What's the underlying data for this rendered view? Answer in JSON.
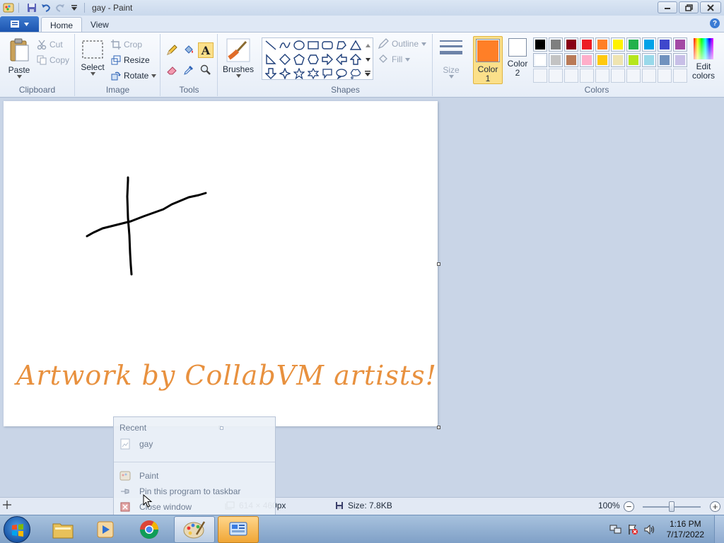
{
  "window": {
    "title": "gay - Paint"
  },
  "tabs": {
    "home": "Home",
    "view": "View"
  },
  "clipboard": {
    "paste": "Paste",
    "cut": "Cut",
    "copy": "Copy",
    "group_label": "Clipboard"
  },
  "image": {
    "select": "Select",
    "crop": "Crop",
    "resize": "Resize",
    "rotate": "Rotate",
    "group_label": "Image"
  },
  "tools": {
    "group_label": "Tools",
    "selected_tool": "text-tool",
    "text_tool_glyph": "A"
  },
  "brushes": {
    "label": "Brushes"
  },
  "shapes": {
    "outline": "Outline",
    "fill": "Fill",
    "group_label": "Shapes"
  },
  "size": {
    "label": "Size"
  },
  "colors": {
    "color1_label": "Color 1",
    "color2_label": "Color 2",
    "edit_label": "Edit colors",
    "group_label": "Colors",
    "color1": "#ff7f27",
    "color2": "#ffffff",
    "palette_row1": [
      "#000000",
      "#7f7f7f",
      "#880015",
      "#ed1c24",
      "#ff7f27",
      "#fff200",
      "#22b14c",
      "#00a2e8",
      "#3f48cc",
      "#a349a4"
    ],
    "palette_row2": [
      "#ffffff",
      "#c3c3c3",
      "#b97a57",
      "#ffaec9",
      "#ffc90e",
      "#efe4b0",
      "#b5e61d",
      "#99d9ea",
      "#7092be",
      "#c8bfe7"
    ]
  },
  "canvas": {
    "watermark": "Artwork by CollabVM artists!"
  },
  "jumplist": {
    "header": "Recent",
    "recent_item": "gay",
    "program": "Paint",
    "pin": "Pin this program to taskbar",
    "close": "Close window"
  },
  "status": {
    "dimensions": "614 × 460px",
    "size": "Size: 7.8KB",
    "zoom": "100%",
    "zoom_fraction": 0.5
  },
  "taskbar": {
    "time": "1:16 PM",
    "date": "7/17/2022"
  }
}
